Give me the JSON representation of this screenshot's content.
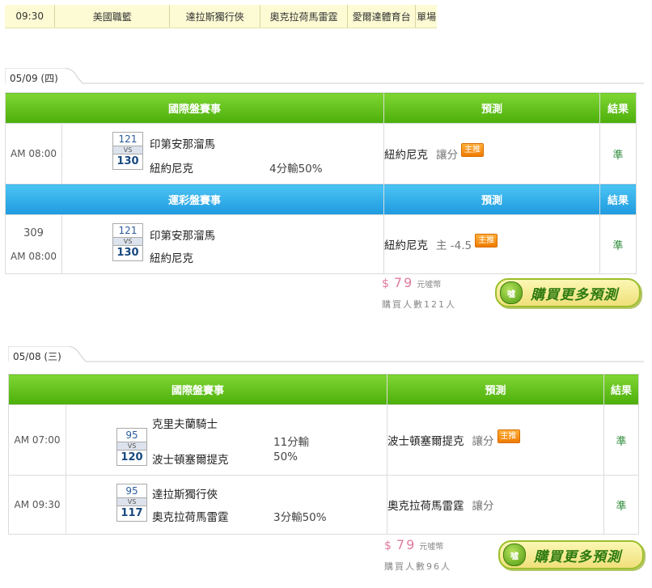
{
  "top_row": {
    "time": "09:30",
    "league": "美國職籃",
    "away": "達拉斯獨行俠",
    "home": "奧克拉荷馬雷霆",
    "venue": "愛爾達體育台",
    "extra": "單場"
  },
  "sections": [
    {
      "date": "05/09 (四)",
      "intl": {
        "header": {
          "event": "國際盤賽事",
          "predict": "預測",
          "result": "結果"
        },
        "rows": [
          {
            "time": "AM 08:00",
            "num1": "121",
            "vs": "VS",
            "num2": "130",
            "team1": "印第安那溜馬",
            "team2": "紐約尼克",
            "odds": "4分輸50%",
            "pred_team": "紐約尼克",
            "pred_type": "讓分",
            "badge": "主推",
            "result": "準"
          }
        ]
      },
      "lottery": {
        "header": {
          "event": "運彩盤賽事",
          "predict": "預測",
          "result": "結果"
        },
        "rows": [
          {
            "game_no": "309",
            "time": "AM 08:00",
            "num1": "121",
            "vs": "VS",
            "num2": "130",
            "team1": "印第安那溜馬",
            "team2": "紐約尼克",
            "pred_team": "紐約尼克",
            "pred_type": "主 -4.5",
            "badge": "主推",
            "result": "準"
          }
        ]
      },
      "price": {
        "dollar": "$",
        "amount": "79",
        "unit": "元噓幣",
        "buyers": "購買人數121人"
      },
      "buy_button": "購買更多預測"
    },
    {
      "date": "05/08 (三)",
      "intl": {
        "header": {
          "event": "國際盤賽事",
          "predict": "預測",
          "result": "結果"
        },
        "rows": [
          {
            "time": "AM 07:00",
            "num1": "95",
            "vs": "VS",
            "num2": "120",
            "team1": "克里夫蘭騎士",
            "team2": "波士頓塞爾提克",
            "odds1": "11分輸",
            "odds2": "50%",
            "pred_team": "波士頓塞爾提克",
            "pred_type": "讓分",
            "badge": "主推",
            "result": "準"
          },
          {
            "time": "AM 09:30",
            "num1": "95",
            "vs": "VS",
            "num2": "117",
            "team1": "達拉斯獨行俠",
            "team2": "奧克拉荷馬雷霆",
            "odds": "3分輸50%",
            "pred_team": "奧克拉荷馬雷霆",
            "pred_type": "讓分",
            "result": "準"
          }
        ]
      },
      "price": {
        "dollar": "$",
        "amount": "79",
        "unit": "元噓幣",
        "buyers": "購買人數96人"
      },
      "buy_button": "購買更多預測"
    }
  ],
  "coin_icon": "coin-icon",
  "colors": {
    "green_header": "#5bbd12",
    "blue_header": "#28a8e8",
    "badge": "#f28a0f",
    "result": "#2e8b3a",
    "price": "#e07aa0"
  }
}
